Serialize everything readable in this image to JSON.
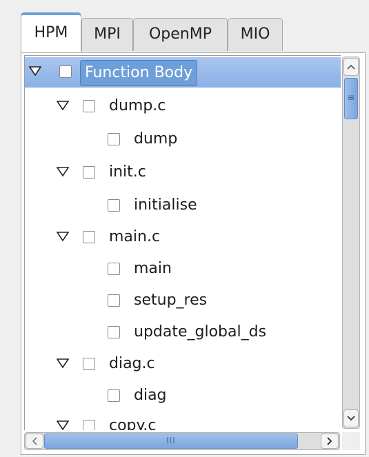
{
  "tabs": [
    {
      "label": "HPM",
      "active": true
    },
    {
      "label": "MPI",
      "active": false
    },
    {
      "label": "OpenMP",
      "active": false
    },
    {
      "label": "MIO",
      "active": false
    }
  ],
  "tree": {
    "root": {
      "label": "Function Body",
      "expanded": true,
      "selected": true,
      "checked": false
    },
    "files": [
      {
        "label": "dump.c",
        "expanded": true,
        "functions": [
          {
            "label": "dump"
          }
        ]
      },
      {
        "label": "init.c",
        "expanded": true,
        "functions": [
          {
            "label": "initialise"
          }
        ]
      },
      {
        "label": "main.c",
        "expanded": true,
        "functions": [
          {
            "label": "main"
          },
          {
            "label": "setup_res"
          },
          {
            "label": "update_global_ds"
          }
        ]
      },
      {
        "label": "diag.c",
        "expanded": true,
        "functions": [
          {
            "label": "diag"
          }
        ]
      },
      {
        "label": "copy.c",
        "expanded": true,
        "functions": []
      }
    ]
  },
  "scrollbars": {
    "vertical": {
      "up_icon": "arrow-up-icon",
      "down_icon": "arrow-down-icon",
      "grip": "≡"
    },
    "horizontal": {
      "left_icon": "arrow-left-icon",
      "right_icon": "arrow-right-icon",
      "grip": "III"
    }
  },
  "colors": {
    "accent": "#6f9fd8",
    "selection": "#8ab0e6"
  }
}
